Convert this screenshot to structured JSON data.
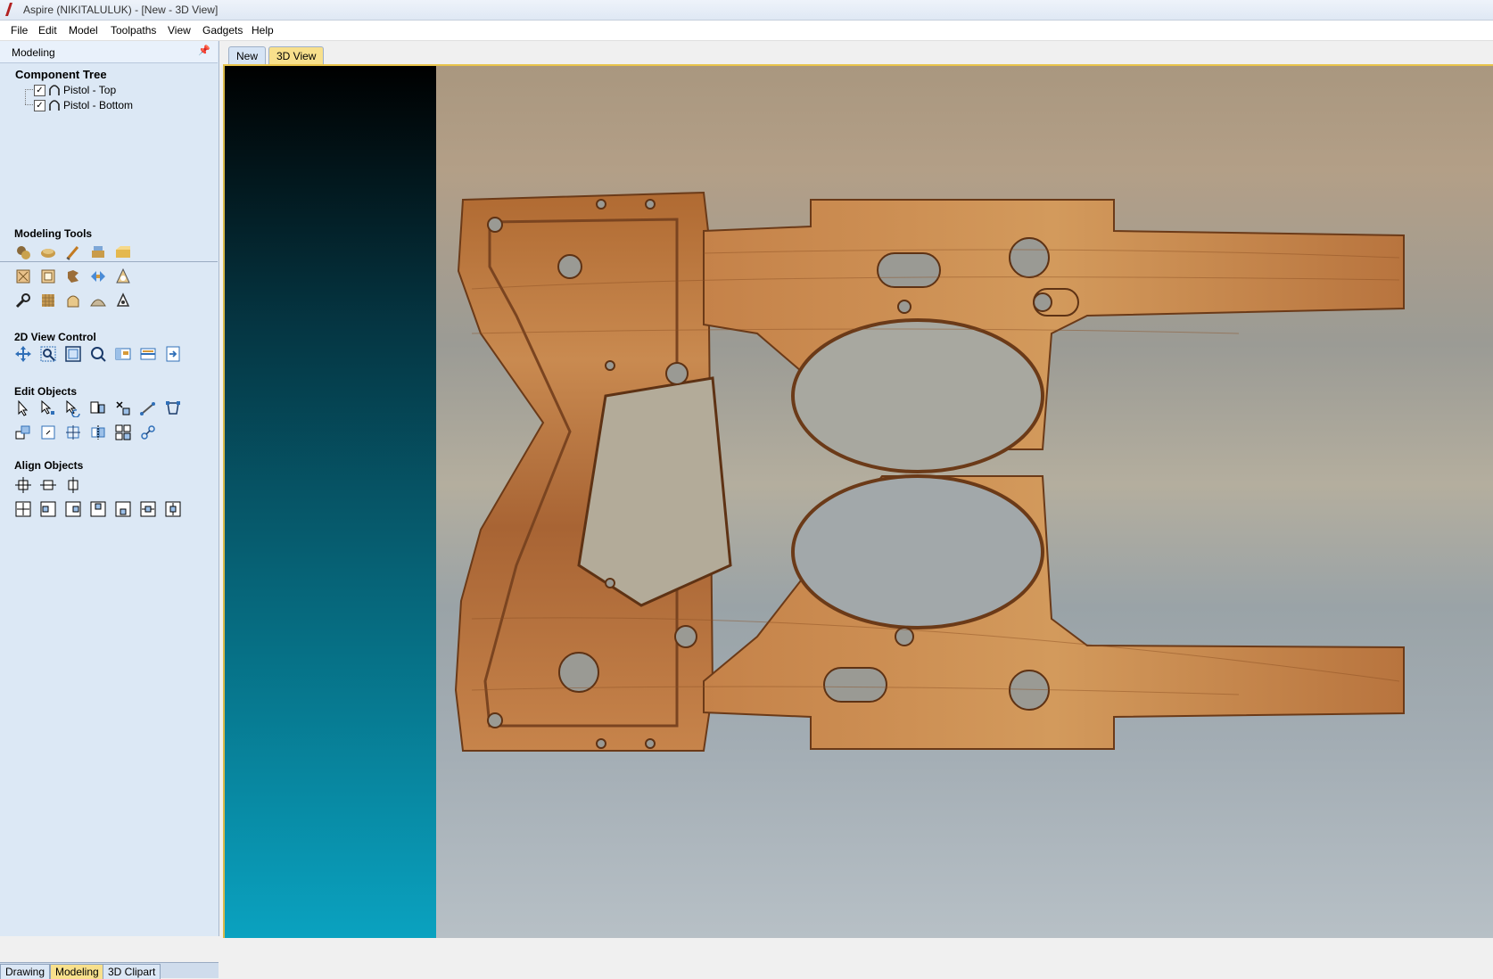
{
  "window": {
    "title": "Aspire (NIKITALULUK) - [New - 3D View]"
  },
  "menu": [
    "File",
    "Edit",
    "Model",
    "Toolpaths",
    "View",
    "Gadgets",
    "Help"
  ],
  "panel": {
    "header": "Modeling",
    "component_tree": {
      "title": "Component Tree",
      "items": [
        {
          "label": "Pistol - Top",
          "checked": true
        },
        {
          "label": "Pistol - Bottom",
          "checked": true
        }
      ]
    },
    "sections": {
      "modeling_tools": "Modeling Tools",
      "view_control": "2D View Control",
      "edit_objects": "Edit Objects",
      "align_objects": "Align Objects"
    },
    "bottom_tabs": [
      "Drawing",
      "Modeling",
      "3D Clipart"
    ],
    "active_bottom_tab": "Modeling"
  },
  "doc_tabs": [
    "New",
    "3D View"
  ],
  "active_doc_tab": "3D View",
  "icons": {
    "modeling_tools": [
      "create-shape-icon",
      "shape-editor-icon",
      "sculpt-icon",
      "extrude-sweep-icon",
      "two-rail-sweep-icon",
      "fade-icon",
      "tilt-icon",
      "distort-icon",
      "mirror-icon",
      "add-draft-icon",
      "smooth-icon",
      "texture-icon",
      "offset-icon",
      "slice-icon",
      "create-vector-boundary-icon"
    ],
    "view_control": [
      "pan-icon",
      "zoom-box-icon",
      "zoom-extents-icon",
      "zoom-selection-icon",
      "toggle-panel-icon",
      "split-view-icon",
      "layer-icon"
    ],
    "edit_objects": [
      "select-icon",
      "node-edit-icon",
      "interactive-transform-icon",
      "size-icon",
      "scale-icon",
      "measure-icon",
      "join-icon",
      "move-icon",
      "rotate-icon",
      "mirror-edit-icon",
      "trim-icon",
      "array-icon",
      "weld-icon"
    ],
    "align_objects": [
      "center-page-icon",
      "center-horizontal-icon",
      "center-vertical-icon",
      "align-center-icon",
      "align-left-icon",
      "align-right-icon",
      "align-top-icon",
      "align-bottom-icon",
      "center-horizontal-align-icon",
      "center-vertical-align-icon"
    ]
  },
  "colors": {
    "panel_bg": "#dce8f5",
    "active_tab": "#f8e08c",
    "viewport_border": "#e8c34a"
  }
}
